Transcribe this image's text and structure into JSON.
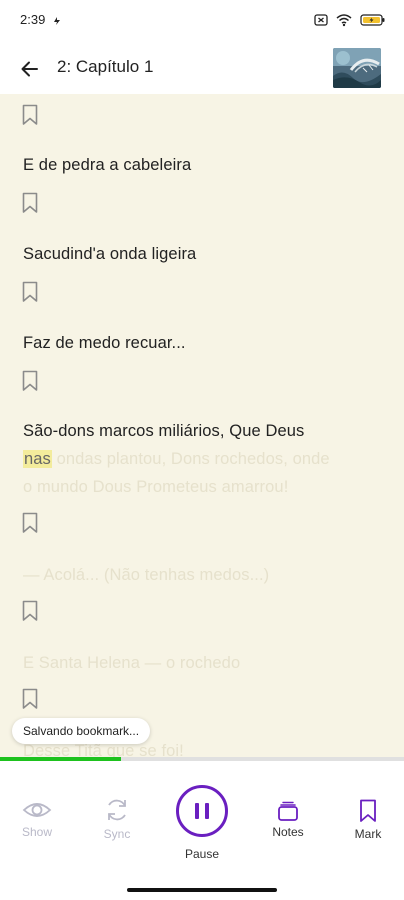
{
  "status": {
    "time": "2:39",
    "icons": [
      "notification-icon",
      "close-box-icon",
      "wifi-icon",
      "battery-icon"
    ]
  },
  "header": {
    "back_icon": "arrow-left-icon",
    "title": "2: Capítulo 1"
  },
  "reading": {
    "lines": [
      "E de pedra a cabeleira",
      "Sacudind'a onda ligeira",
      "Faz de medo recuar..."
    ],
    "active_line": {
      "first": "São-dons marcos miliários, Que Deus",
      "highlight": "nas",
      "rest": " ondas plantou, Dons rochedos, onde",
      "second": "o mundo Dous Prometeus amarrou!"
    },
    "faded_lines": [
      "— Acolá... (Não tenhas medos...)",
      "E Santa Helena — o rochedo",
      "Desse Titã que se foi!"
    ],
    "bookmark_icon": "bookmark-outline-icon"
  },
  "toast": {
    "text": "Salvando bookmark..."
  },
  "progress": {
    "fraction": 0.3
  },
  "toolbar": {
    "show": {
      "label": "Show",
      "icon": "eye-icon"
    },
    "sync": {
      "label": "Sync",
      "icon": "sync-icon"
    },
    "pause": {
      "label": "Pause",
      "icon": "pause-icon"
    },
    "notes": {
      "label": "Notes",
      "icon": "notes-icon"
    },
    "mark": {
      "label": "Mark",
      "icon": "bookmark-icon"
    }
  },
  "colors": {
    "accent": "#6a1fc0",
    "progress": "#1ec21e",
    "page_bg": "#f7f4e5",
    "highlight": "#f3ec9c"
  }
}
